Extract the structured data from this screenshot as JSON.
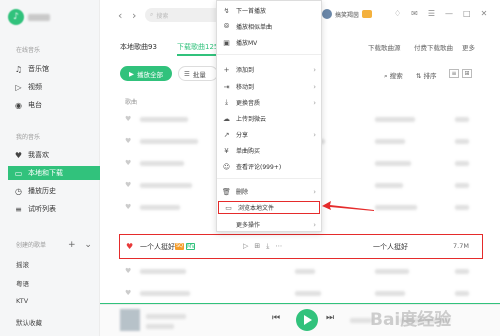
{
  "sidebar": {
    "section_online": "在线音乐",
    "online": [
      "音乐馆",
      "视频",
      "电台"
    ],
    "section_mine": "我的音乐",
    "mine": [
      "我喜欢",
      "本地和下载",
      "播放历史",
      "试听列表"
    ],
    "section_created": "创建的歌单",
    "playlists": [
      "摇滚",
      "粤语",
      "KTV",
      "默认收藏"
    ],
    "tools": [
      "+",
      "⌄"
    ]
  },
  "topbar": {
    "nav": [
      "‹",
      "›"
    ],
    "search_placeholder": "搜索",
    "username": "搞笑羯茵",
    "icons": [
      "♢",
      "✉",
      "☰",
      "—",
      "□",
      "✕"
    ]
  },
  "tabs": {
    "local": "本地歌曲93",
    "download": "下载歌曲125",
    "links": [
      "下载歌曲源",
      "付费下载歌曲",
      "更多"
    ]
  },
  "toolbar": {
    "play_all": "播放全部",
    "batch": "批量",
    "search": "搜索",
    "sort": "排序"
  },
  "list": {
    "col_song": "歌曲"
  },
  "context_menu": {
    "items": [
      {
        "icon": "↯",
        "label": "下一首播放",
        "arrow": ""
      },
      {
        "icon": "⦾",
        "label": "播放相似单曲",
        "arrow": ""
      },
      {
        "icon": "▣",
        "label": "播放MV",
        "arrow": ""
      },
      {
        "icon": "+",
        "label": "添加到",
        "arrow": "›"
      },
      {
        "icon": "⇥",
        "label": "移动到",
        "arrow": "›"
      },
      {
        "icon": "⤓",
        "label": "更换音质",
        "arrow": "›"
      },
      {
        "icon": "☁",
        "label": "上传到微云",
        "arrow": ""
      },
      {
        "icon": "↗",
        "label": "分享",
        "arrow": "›"
      },
      {
        "icon": "¥",
        "label": "单曲购买",
        "arrow": ""
      },
      {
        "icon": "☺",
        "label": "查看评论(999+)",
        "arrow": ""
      },
      {
        "icon": "🗑",
        "label": "删除",
        "arrow": "›"
      },
      {
        "icon": "▭",
        "label": "浏览本地文件",
        "arrow": ""
      },
      {
        "icon": "",
        "label": "更多操作",
        "arrow": "›"
      }
    ]
  },
  "highlighted_song": {
    "title": "一个人挺好",
    "tags": [
      "SQ",
      "MV"
    ],
    "artist": "一个人挺好",
    "size": "7.7M",
    "actions": [
      "▷",
      "⊞",
      "⤓",
      "⋯"
    ]
  },
  "player": {
    "controls": [
      "⏮",
      "⏭"
    ]
  },
  "watermark": "Bai度经验",
  "colors": {
    "accent": "#31c27c",
    "highlight": "#e52b2b"
  }
}
